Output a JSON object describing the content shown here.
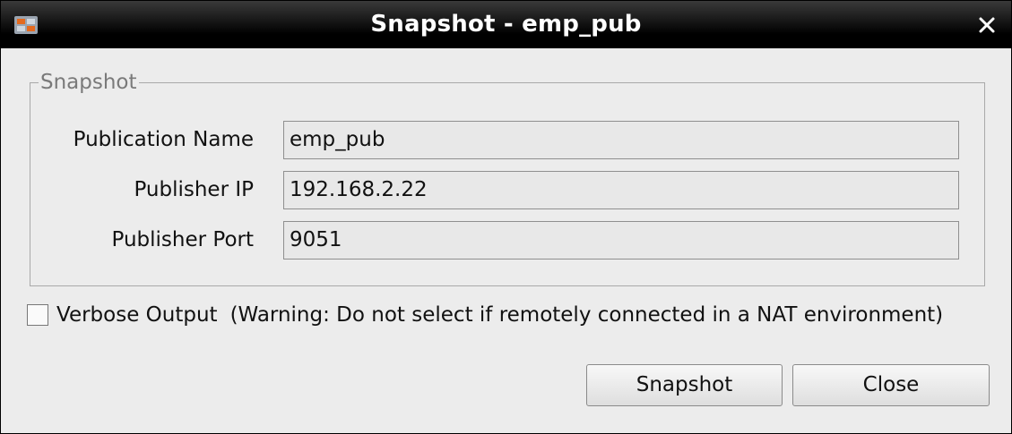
{
  "window": {
    "title": "Snapshot - emp_pub",
    "app_icon": "app-logo-icon",
    "close_icon": "close-icon"
  },
  "group": {
    "legend": "Snapshot",
    "fields": [
      {
        "label": "Publication Name",
        "value": "emp_pub"
      },
      {
        "label": "Publisher IP",
        "value": "192.168.2.22"
      },
      {
        "label": "Publisher Port",
        "value": "9051"
      }
    ]
  },
  "options": {
    "verbose_label": "Verbose Output",
    "verbose_warning": "(Warning: Do not select if remotely connected in a NAT environment)",
    "verbose_checked": false
  },
  "buttons": {
    "snapshot": "Snapshot",
    "close": "Close"
  }
}
